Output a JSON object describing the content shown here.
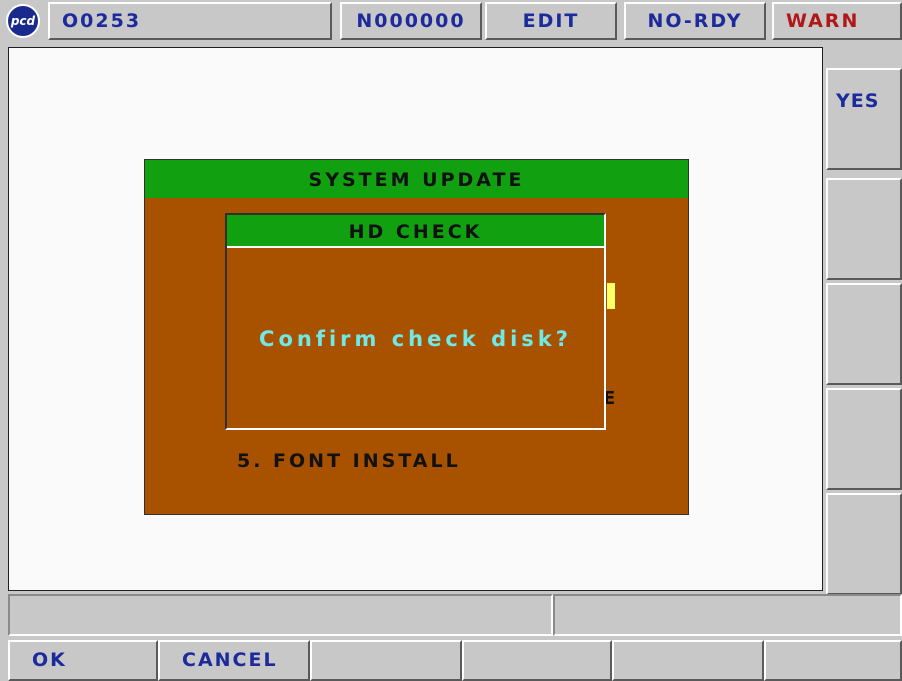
{
  "header": {
    "logo_text": "pcd",
    "program": "O0253",
    "sequence": "N000000",
    "mode": "EDIT",
    "ready_status": "NO-RDY",
    "warning": "WARN"
  },
  "side_softkeys": [
    "YES",
    "",
    "",
    "",
    ""
  ],
  "dialog": {
    "title": "SYSTEM UPDATE",
    "menu_item": "5. FONT INSTALL",
    "obscured_fragment": "E"
  },
  "confirm": {
    "title": "HD CHECK",
    "message": "Confirm check disk?"
  },
  "bottom_softkeys": [
    "OK",
    "CANCEL",
    "",
    "",
    "",
    ""
  ],
  "colors": {
    "label_blue": "#1c2a9c",
    "warn_red": "#b01818",
    "title_green": "#10a010",
    "dialog_brown": "#a85200",
    "message_cyan": "#6ee8e8",
    "cursor_yellow": "#ffff66"
  }
}
